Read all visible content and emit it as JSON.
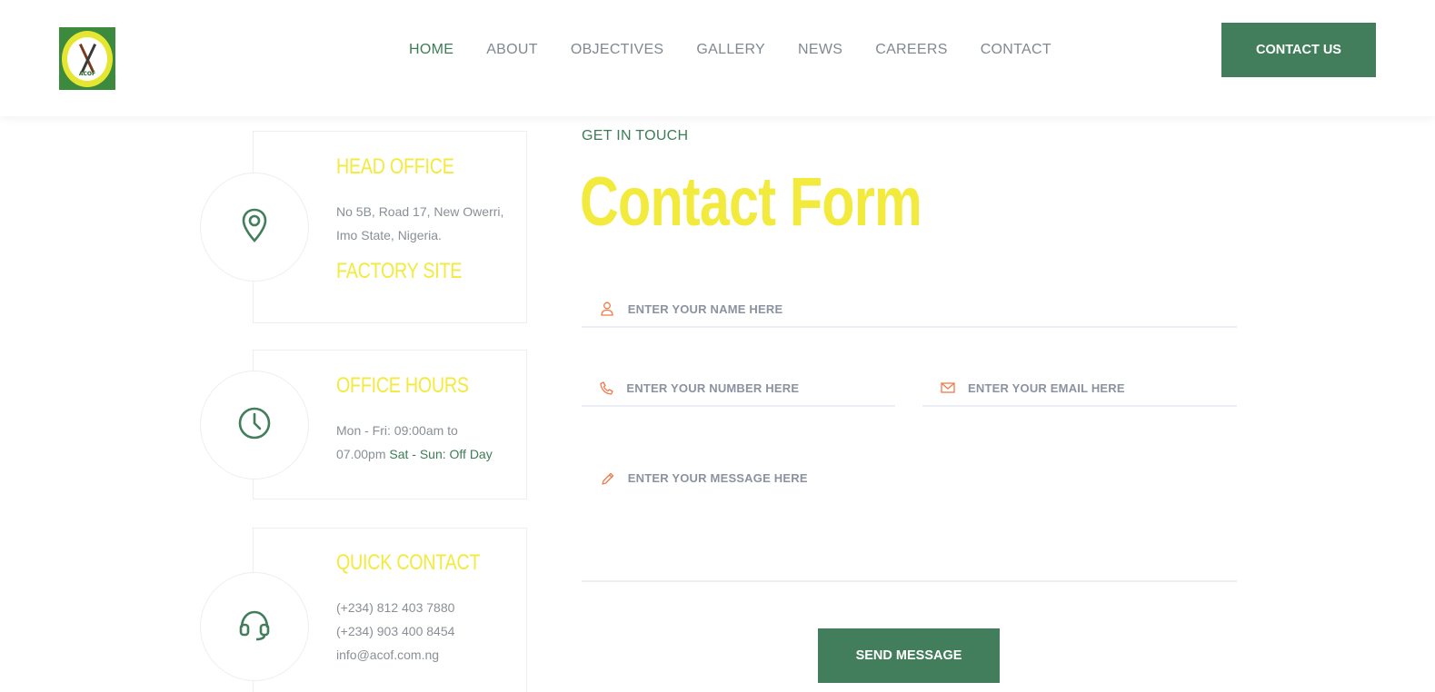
{
  "header": {
    "logo_text": "ACOF",
    "nav": [
      "HOME",
      "ABOUT",
      "OBJECTIVES",
      "GALLERY",
      "NEWS",
      "CAREERS",
      "CONTACT"
    ],
    "active_nav": "HOME",
    "cta_label": "CONTACT US"
  },
  "info": {
    "head_office": {
      "title": "HEAD OFFICE",
      "address_line1": "No 5B, Road 17, New Owerri,",
      "address_line2": "Imo State, Nigeria.",
      "factory_title": "FACTORY SITE",
      "icon": "location-pin-icon"
    },
    "office_hours": {
      "title": "OFFICE HOURS",
      "line1": "Mon - Fri: 09:00am to",
      "line2_prefix": "07.00pm",
      "line2_highlight": "Sat - Sun: Off Day",
      "icon": "clock-icon"
    },
    "quick_contact": {
      "title": "QUICK CONTACT",
      "phone1": "(+234) 812 403 7880",
      "phone2": "(+234) 903 400 8454",
      "email": "info@acof.com.ng",
      "icon": "headset-icon"
    }
  },
  "form": {
    "eyebrow": "GET IN TOUCH",
    "title": "Contact Form",
    "name_placeholder": "ENTER YOUR NAME HERE",
    "number_placeholder": "ENTER YOUR NUMBER HERE",
    "email_placeholder": "ENTER YOUR EMAIL HERE",
    "message_placeholder": "ENTER YOUR MESSAGE HERE",
    "submit_label": "SEND MESSAGE"
  },
  "colors": {
    "brand_green": "#427e5b",
    "accent_yellow": "#f2ea3c",
    "icon_orange": "#f27a4a"
  }
}
